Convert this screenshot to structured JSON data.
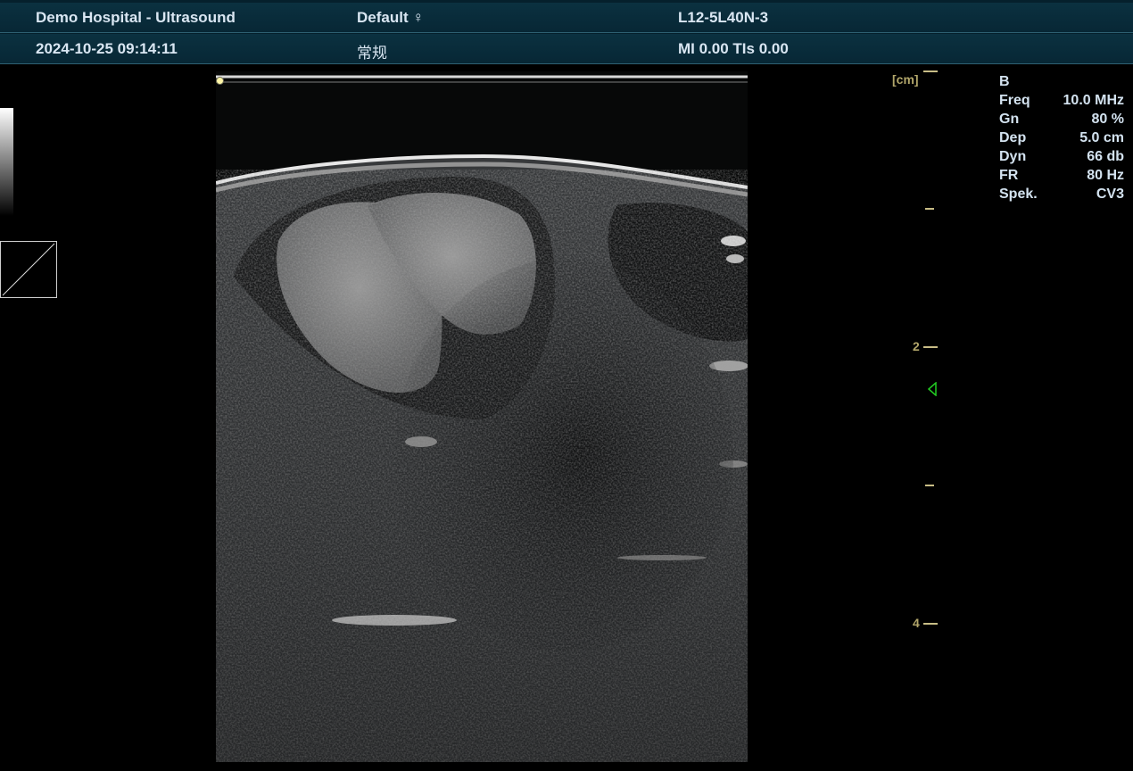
{
  "header": {
    "hospital": "Demo Hospital - Ultrasound",
    "preset": "Default",
    "gender_symbol": "♀",
    "probe": "L12-5L40N-3",
    "datetime": "2024-10-25 09:14:11",
    "exam_type": "常规",
    "mi_tis": "MI 0.00 TIs 0.00"
  },
  "scale": {
    "unit": "[cm]",
    "labels": [
      "2",
      "4"
    ]
  },
  "params": {
    "mode": "B",
    "rows": [
      {
        "label": "Freq",
        "value": "10.0 MHz"
      },
      {
        "label": "Gn",
        "value": "80 %"
      },
      {
        "label": "Dep",
        "value": "5.0 cm"
      },
      {
        "label": "Dyn",
        "value": "66 db"
      },
      {
        "label": "FR",
        "value": "80 Hz"
      },
      {
        "label": "Spek.",
        "value": "CV3"
      }
    ]
  },
  "colors": {
    "header_bg": "#0b3140",
    "scale": "#b2a66a",
    "focus_marker": "#22cc22",
    "text": "#d3e2ef"
  }
}
